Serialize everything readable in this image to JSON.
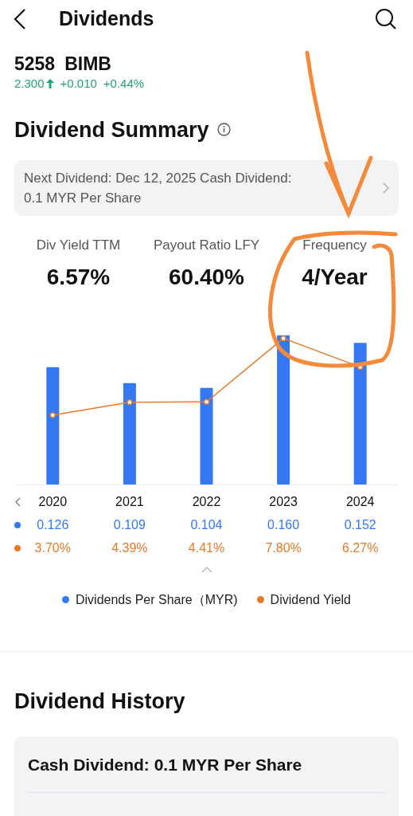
{
  "header": {
    "title": "Dividends"
  },
  "stock": {
    "code": "5258",
    "name": "BIMB",
    "price": "2.300",
    "change": "+0.010",
    "change_pct": "+0.44%"
  },
  "summary": {
    "title": "Dividend Summary",
    "next_dividend": [
      "Next Dividend: Dec 12, 2025 Cash Dividend:",
      "0.1 MYR Per Share"
    ],
    "stats": [
      {
        "label": "Div Yield TTM",
        "value": "6.57%"
      },
      {
        "label": "Payout Ratio LFY",
        "value": "60.40%"
      },
      {
        "label": "Frequency",
        "value": "4/Year"
      }
    ],
    "table": {
      "years": [
        "2020",
        "2021",
        "2022",
        "2023",
        "2024"
      ],
      "rows": [
        {
          "kind": "bar",
          "color": "#3478f6",
          "cells": [
            "0.126",
            "0.109",
            "0.104",
            "0.160",
            "0.152"
          ]
        },
        {
          "kind": "line",
          "color": "#e87a2a",
          "cells": [
            "3.70%",
            "4.39%",
            "4.41%",
            "7.80%",
            "6.27%"
          ]
        }
      ]
    },
    "legend": [
      {
        "label": "Dividends Per Share（MYR)",
        "color": "#3478f6"
      },
      {
        "label": "Dividend Yield",
        "color": "#e87a2a"
      }
    ]
  },
  "history": {
    "title": "Dividend History",
    "items": [
      {
        "title": "Cash Dividend: 0.1 MYR Per Share"
      }
    ]
  }
}
